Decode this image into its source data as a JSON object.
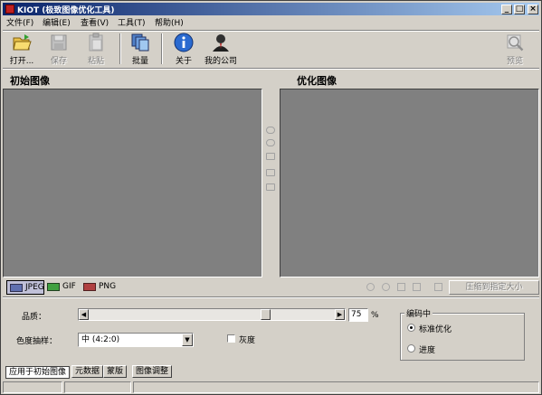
{
  "window": {
    "title": "KIOT (极致图像优化工具)"
  },
  "menu": [
    "文件(F)",
    "编辑(E)",
    "查看(V)",
    "工具(T)",
    "帮助(H)"
  ],
  "toolbar": {
    "open": "打开...",
    "save": "保存",
    "paste": "粘贴",
    "batch": "批量",
    "about": "关于",
    "company": "我的公司",
    "preview": "预览"
  },
  "panels": {
    "original": "初始图像",
    "optimized": "优化图像"
  },
  "formats": {
    "jpeg": "JPEG",
    "gif": "GIF",
    "png": "PNG"
  },
  "compress_button": "压缩到指定大小",
  "settings": {
    "quality_label": "品质：",
    "quality_value": "75",
    "quality_unit": "%",
    "quality_fraction": 0.73,
    "chroma_label": "色度抽样：",
    "chroma_value": "中 (4:2:0)",
    "grayscale_label": "灰度",
    "encoding_title": "编码中",
    "encoding_standard": "标准优化",
    "encoding_progressive": "进度"
  },
  "bottom_tabs": [
    "应用于初始图像",
    "元数据",
    "蒙版",
    "图像调整"
  ],
  "colors": {
    "title_start": "#0a246a",
    "title_end": "#a6caf0",
    "face": "#d4d0c8",
    "pane": "#808080"
  }
}
